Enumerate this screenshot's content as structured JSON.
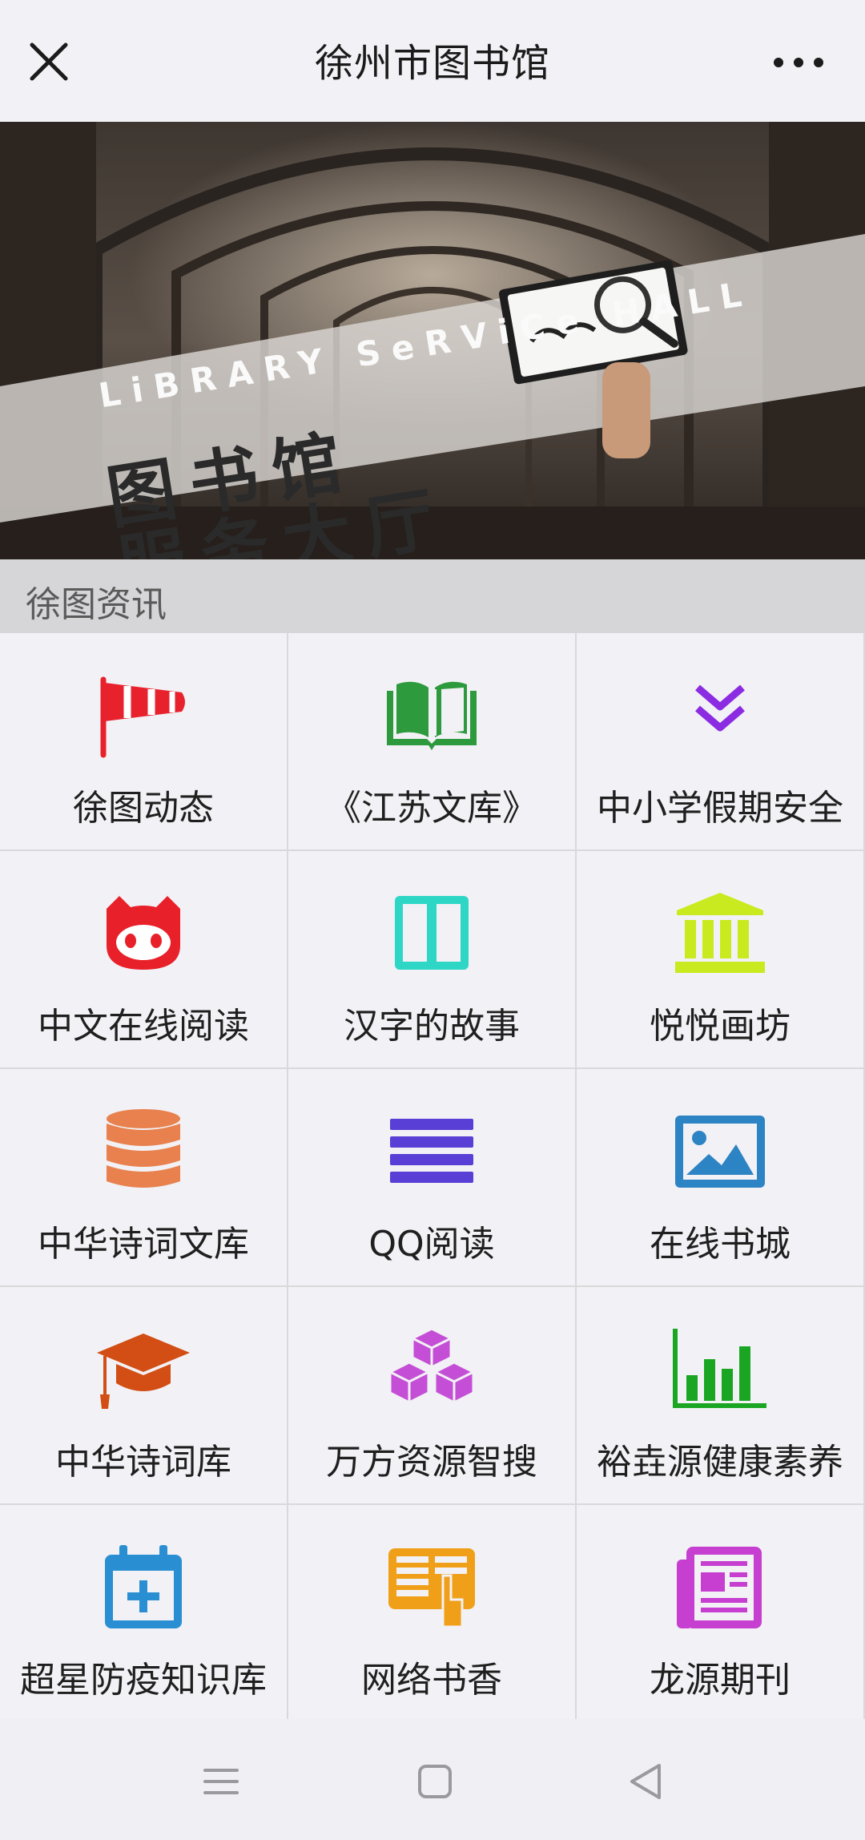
{
  "header": {
    "title": "徐州市图书馆",
    "close_icon": "close-icon",
    "more_icon": "more-icon"
  },
  "banner": {
    "text_en": "LiBRARY SeRViCe HALL",
    "text_cn_line1": "图书馆",
    "text_cn_line2": "服务大厅",
    "slide_count": 1,
    "active_slide": 1
  },
  "section": {
    "title": "徐图资讯"
  },
  "grid": {
    "items": [
      {
        "label": "徐图动态",
        "icon": "windsock-icon",
        "color": "#e8222d"
      },
      {
        "label": "《江苏文库》",
        "icon": "open-book-icon",
        "color": "#2e9a3e"
      },
      {
        "label": "中小学假期安全",
        "icon": "double-chevron-down-icon",
        "color": "#8b2be2"
      },
      {
        "label": "中文在线阅读",
        "icon": "cat-icon",
        "color": "#e8202a"
      },
      {
        "label": "汉字的故事",
        "icon": "columns-icon",
        "color": "#2ed6c6"
      },
      {
        "label": "悦悦画坊",
        "icon": "bank-icon",
        "color": "#c9ea1e"
      },
      {
        "label": "中华诗词文库",
        "icon": "database-icon",
        "color": "#e8814e"
      },
      {
        "label": "QQ阅读",
        "icon": "list-icon",
        "color": "#5a3fd6"
      },
      {
        "label": "在线书城",
        "icon": "image-icon",
        "color": "#2d84c4"
      },
      {
        "label": "中华诗词库",
        "icon": "graduation-cap-icon",
        "color": "#d24e14"
      },
      {
        "label": "万方资源智搜",
        "icon": "cubes-icon",
        "color": "#c44fd6"
      },
      {
        "label": "裕垚源健康素养",
        "icon": "bar-chart-icon",
        "color": "#1aa622"
      },
      {
        "label": "超星防疫知识库",
        "icon": "calendar-plus-icon",
        "color": "#2a8fd2"
      },
      {
        "label": "网络书香",
        "icon": "newspaper-hand-icon",
        "color": "#f0a018"
      },
      {
        "label": "龙源期刊",
        "icon": "newspaper-icon",
        "color": "#c63fd0"
      }
    ]
  },
  "navbar": {
    "menu_icon": "menu-icon",
    "home_icon": "home-square-icon",
    "back_icon": "back-triangle-icon"
  }
}
